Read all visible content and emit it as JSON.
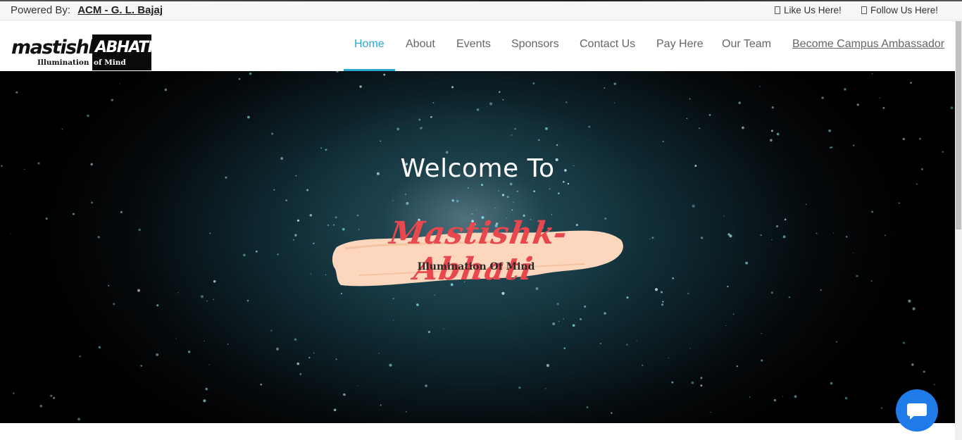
{
  "topbar": {
    "powered_label": "Powered By:",
    "powered_link": "ACM - G. L. Bajaj",
    "like": "Like Us Here!",
    "follow": "Follow Us Here!"
  },
  "logo": {
    "word_left": "mastishk",
    "word_right": "ABHATI",
    "sub_left": "Illumination",
    "sub_right": "of Mind"
  },
  "nav": {
    "items": [
      {
        "label": "Home"
      },
      {
        "label": "About"
      },
      {
        "label": "Events"
      },
      {
        "label": "Sponsors"
      },
      {
        "label": "Contact Us"
      },
      {
        "label": "Pay Here"
      },
      {
        "label": "Our Team"
      },
      {
        "label": "Become Campus Ambassador"
      }
    ],
    "active": "Home"
  },
  "hero": {
    "welcome": "Welcome To",
    "brand": "Mastishk-Abhati",
    "tagline": "Illumination Of Mind"
  },
  "colors": {
    "accent": "#2aa7d6",
    "brand_red": "#e7474d",
    "brush": "#fdd7bd",
    "chat": "#1f7be8"
  },
  "icons": {
    "like": "facebook-icon",
    "follow": "instagram-icon",
    "chat": "chat-icon"
  }
}
